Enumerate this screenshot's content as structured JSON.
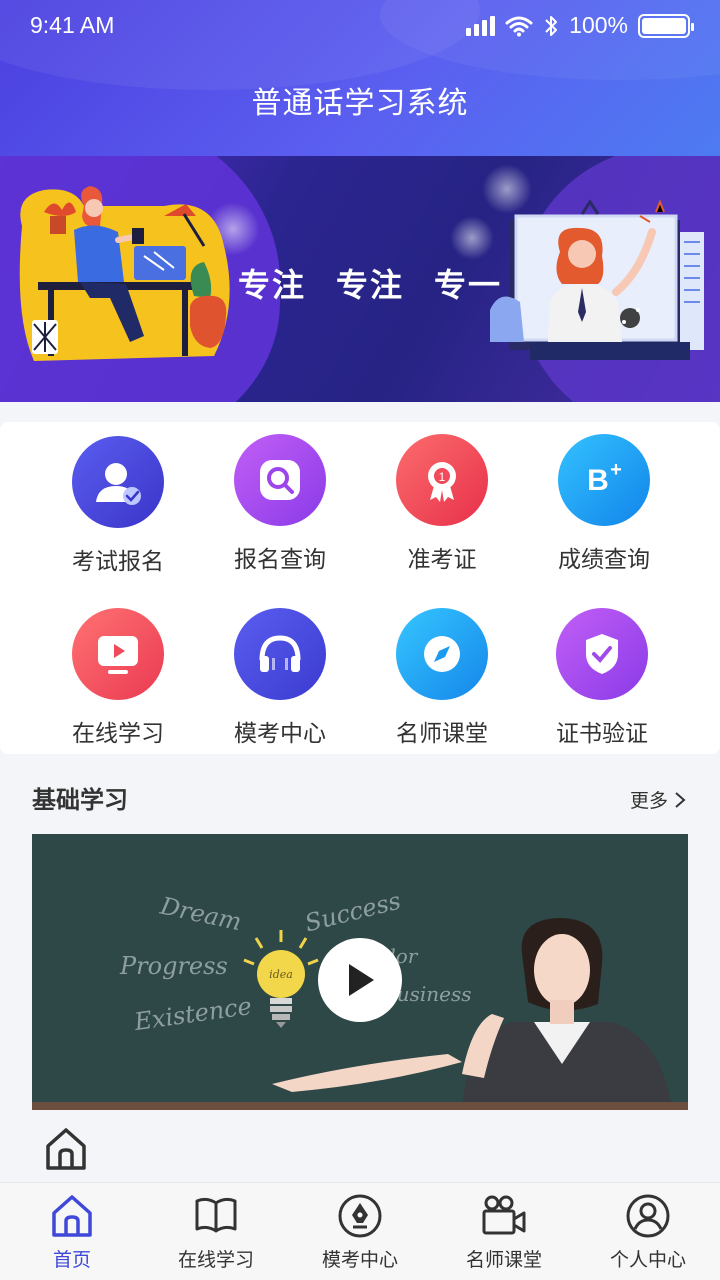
{
  "status_bar": {
    "time": "9:41 AM",
    "battery": "100%"
  },
  "header": {
    "title": "普通话学习系统"
  },
  "banner": {
    "slogan": [
      "专注",
      "专注",
      "专一"
    ]
  },
  "grid": [
    {
      "label": "考试报名",
      "icon": "user-check-icon",
      "color": "#4b49e0"
    },
    {
      "label": "报名查询",
      "icon": "search-icon",
      "color": "#a64cf0"
    },
    {
      "label": "准考证",
      "icon": "ribbon-badge-icon",
      "color": "#f0485a"
    },
    {
      "label": "成绩查询",
      "icon": "grade-b-plus-icon",
      "color": "#1aa3f5"
    },
    {
      "label": "在线学习",
      "icon": "play-screen-icon",
      "color": "#f04a5a"
    },
    {
      "label": "模考中心",
      "icon": "headphones-icon",
      "color": "#4a4ee6"
    },
    {
      "label": "名师课堂",
      "icon": "compass-icon",
      "color": "#1ba2f2"
    },
    {
      "label": "证书验证",
      "icon": "shield-check-icon",
      "color": "#a24ef2"
    }
  ],
  "section": {
    "title": "基础学习",
    "more": "更多"
  },
  "video": {
    "words": [
      "Dream",
      "Success",
      "Progress",
      "Existence",
      "idea",
      "Color",
      "Business"
    ]
  },
  "tabbar": [
    {
      "label": "首页",
      "icon": "home-icon",
      "active": true
    },
    {
      "label": "在线学习",
      "icon": "book-icon",
      "active": false
    },
    {
      "label": "模考中心",
      "icon": "pen-nib-icon",
      "active": false
    },
    {
      "label": "名师课堂",
      "icon": "video-camera-icon",
      "active": false
    },
    {
      "label": "个人中心",
      "icon": "profile-icon",
      "active": false
    }
  ],
  "colors": {
    "accent": "#3f48d8",
    "header_start": "#4b3fe0",
    "header_end": "#4d7bf2"
  }
}
